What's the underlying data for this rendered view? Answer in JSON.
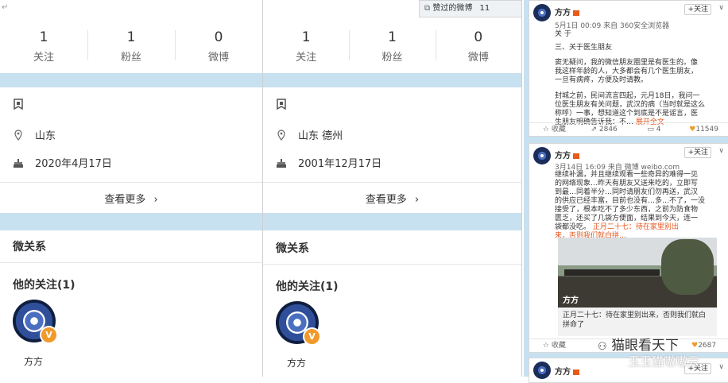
{
  "panel1": {
    "stats": [
      {
        "num": "1",
        "label": "关注"
      },
      {
        "num": "1",
        "label": "粉丝"
      },
      {
        "num": "0",
        "label": "微博"
      }
    ],
    "location": "山东",
    "birthday": "2020年4月17日",
    "see_more": "查看更多",
    "weibo_relation": "微关系",
    "his_follows": "他的关注(1)",
    "avatar_name": "方方",
    "badge": "V"
  },
  "panel2": {
    "liked_weibo": "赞过的微博",
    "liked_count": "11",
    "stats": [
      {
        "num": "1",
        "label": "关注"
      },
      {
        "num": "1",
        "label": "粉丝"
      },
      {
        "num": "0",
        "label": "微博"
      }
    ],
    "location": "山东 德州",
    "birthday": "2001年12月17日",
    "see_more": "查看更多",
    "weibo_relation": "微关系",
    "his_follows": "他的关注(1)",
    "avatar_name": "方方",
    "badge": "V"
  },
  "feed": {
    "posts": [
      {
        "name": "方方",
        "follow": "+关注",
        "meta": "5月1日 00:09 来自 360安全浏览器",
        "lines": [
          "关 于",
          "三、关于医生朋友",
          "窦无疑问，我的微信朋友圈里是有医生的。像",
          "我这样年龄的人，大多都会有几个医生朋友，",
          "一旦有病疼，方便及时请教。",
          "封城之前，民间流言四起，元月18日，我问一",
          "位医生朋友有关问题，武汉的病（当时就是这么",
          "称呼）一事，想知道这个到底是不是谣言，医",
          "生朋友明确告诉我：不…"
        ],
        "expand": "展开全文",
        "actions": [
          "收藏",
          "2846",
          "4",
          "11549"
        ]
      },
      {
        "name": "方方",
        "follow": "+关注",
        "meta": "3月14日 16:09 来自 微博 weibo.com",
        "lines": [
          "继续补漏，并且继续观看一些奇异的难得一见",
          "的网络现象…昨天有朋友又送来吃的，立即写",
          "到最…同着半分…同时请朋友们勿再送，武汉",
          "的供应已经丰富，目前也没有…多…不了，一没",
          "接受了，根本吃不了多少东西，之前为防食物",
          "匮乏，还买了几袋方便面，结果到今天，连一",
          "袋都没吃。"
        ],
        "quote_link": "正月二十七：待在家里别出",
        "quote_rest": "来，否则我们就白拼…",
        "photo_label": "方方",
        "caption": "正月二十七：待在家里别出来，否则我们就白拼命了",
        "actions": [
          "收藏",
          "",
          "",
          "2687"
        ]
      },
      {
        "name": "方方",
        "follow": "+关注"
      }
    ]
  },
  "watermark": "猫眼看天下",
  "watermark2": "玉玉猫嗷嗷云"
}
